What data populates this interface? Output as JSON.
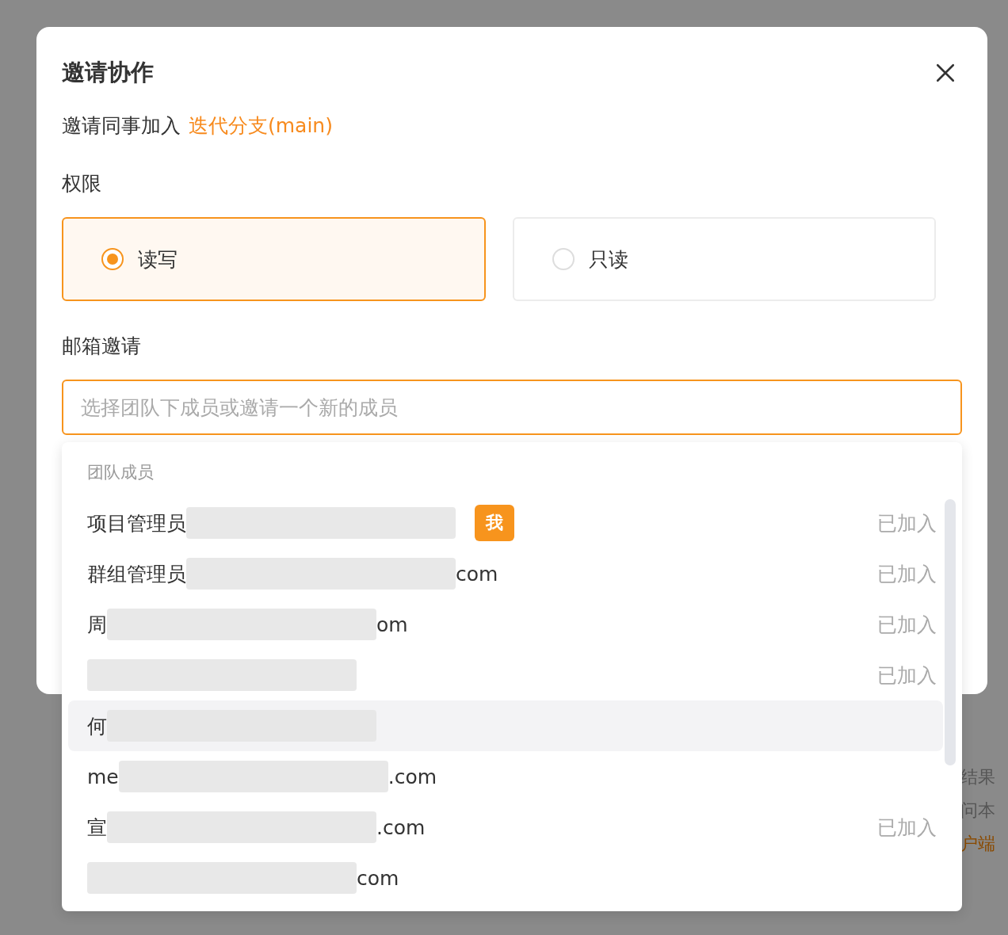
{
  "background": {
    "side_texts": [
      {
        "text": "结果",
        "kind": "plain"
      },
      {
        "text": "问本",
        "kind": "plain"
      },
      {
        "text": "户端",
        "kind": "accent"
      }
    ]
  },
  "modal": {
    "title": "邀请协作",
    "subtitle": "邀请同事加入",
    "subtitle_link": "迭代分支(main)",
    "permission_label": "权限",
    "permissions": [
      {
        "label": "读写",
        "selected": true
      },
      {
        "label": "只读",
        "selected": false
      }
    ],
    "email_label": "邮箱邀请",
    "email_field": {
      "placeholder": "选择团队下成员或邀请一个新的成员"
    },
    "dropdown": {
      "group_label": "团队成员",
      "members": [
        {
          "name": "项目管理员",
          "badge": "我",
          "status": "已加入",
          "selected": false
        },
        {
          "name": "群组管理员",
          "email_tail": "com",
          "status": "已加入",
          "selected": false
        },
        {
          "name": "周",
          "email_tail": "om",
          "status": "已加入",
          "selected": false
        },
        {
          "status": "已加入",
          "selected": false
        },
        {
          "name": "何",
          "selected": true
        },
        {
          "name": "me",
          "email_tail": ".com",
          "selected": false
        },
        {
          "name": "宣",
          "email_tail": ".com",
          "status": "已加入",
          "selected": false
        },
        {
          "email_tail": "com",
          "selected": false
        }
      ]
    }
  }
}
